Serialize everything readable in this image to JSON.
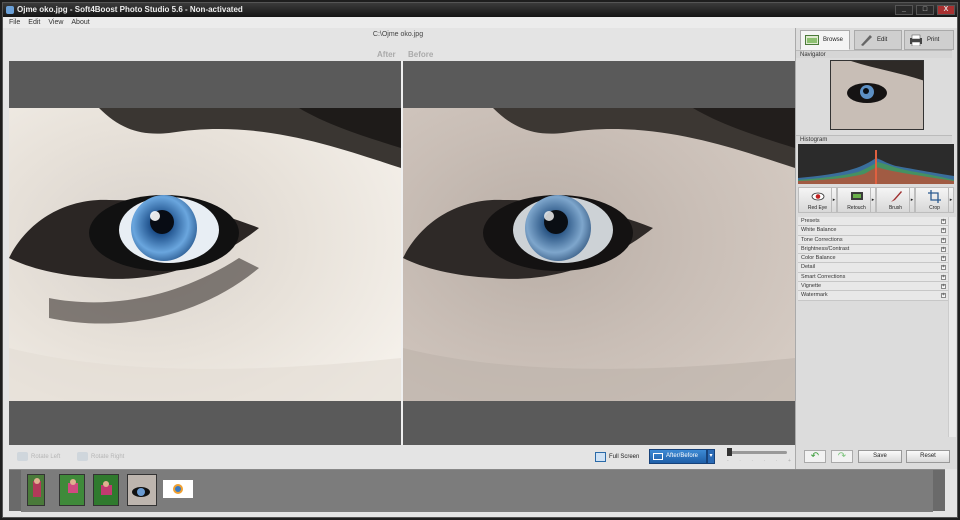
{
  "window": {
    "title": "Ojme oko.jpg - Soft4Boost Photo Studio 5.6 - Non-activated",
    "controls": [
      "_",
      "□",
      "X"
    ]
  },
  "menu": [
    "File",
    "Edit",
    "View",
    "About"
  ],
  "file_path": "C:\\Ojme oko.jpg",
  "view_labels": {
    "after": "After",
    "before": "Before"
  },
  "bottom_toolbar": {
    "rotate_left": "Rotate Left",
    "rotate_right": "Rotate Right",
    "full_screen": "Full Screen",
    "view_mode": "After/Before",
    "zoom_ticks": [
      "-",
      "·",
      "·",
      "·",
      "·",
      "+"
    ],
    "zoom_level": 0
  },
  "right_tabs": {
    "browse": "Browse",
    "edit": "Edit",
    "print": "Print"
  },
  "panel": {
    "navigator_title": "Navigator",
    "histogram_title": "Histogram"
  },
  "tools": [
    {
      "label": "Red Eye",
      "icon": "red-eye-icon"
    },
    {
      "label": "Retouch",
      "icon": "retouch-icon"
    },
    {
      "label": "Brush",
      "icon": "brush-icon"
    },
    {
      "label": "Crop",
      "icon": "crop-icon"
    }
  ],
  "adjustments": [
    "Presets",
    "White Balance",
    "Tone Corrections",
    "Brightness/Contrast",
    "Color Balance",
    "Detail",
    "Smart Corrections",
    "Vignette",
    "Watermark"
  ],
  "actions": {
    "save": "Save",
    "reset": "Reset"
  },
  "thumbnails": [
    "girl-photo",
    "girl-on-grass",
    "girl-on-grass-2",
    "husky-eye",
    "logo-image"
  ],
  "colors": {
    "accent": "#2a6ab5",
    "viewer_bg": "#595959",
    "panel_bg": "#dcdcdc"
  }
}
